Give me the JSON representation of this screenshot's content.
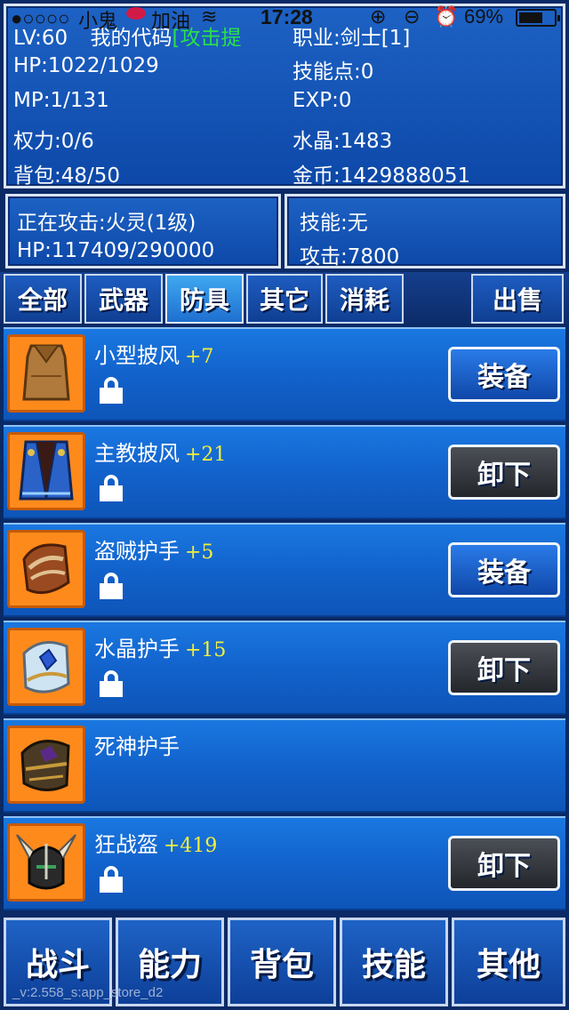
{
  "status_bar": {
    "signal": "●○○○○",
    "carrier": "小鬼",
    "carrier_suffix": "加油",
    "time": "17:28",
    "battery": "69%",
    "battery_level": 0.69
  },
  "player": {
    "level": "LV:60",
    "name_prefix": "我的代码",
    "name_suffix": "[攻击提",
    "class": "职业:剑士[1]",
    "hp": "HP:1022/1029",
    "skill_points": "技能点:0",
    "mp": "MP:1/131",
    "exp": "EXP:0",
    "power": "权力:0/6",
    "crystal": "水晶:1483",
    "bag": "背包:48/50",
    "gold": "金币:1429888051"
  },
  "target": {
    "attacking": "正在攻击:火灵(1级)",
    "hp": "HP:117409/290000"
  },
  "skill": {
    "name": "技能:无",
    "attack": "攻击:7800"
  },
  "tabs": [
    {
      "label": "全部",
      "active": false
    },
    {
      "label": "武器",
      "active": false
    },
    {
      "label": "防具",
      "active": true
    },
    {
      "label": "其它",
      "active": false
    },
    {
      "label": "消耗",
      "active": false
    }
  ],
  "sell_label": "出售",
  "items": [
    {
      "name": "小型披风",
      "bonus": "+7",
      "locked": true,
      "action": "装备",
      "icon": "cloak-brown-icon"
    },
    {
      "name": "主教披风",
      "bonus": "+21",
      "locked": true,
      "action": "卸下",
      "icon": "cloak-blue-icon"
    },
    {
      "name": "盗贼护手",
      "bonus": "+5",
      "locked": true,
      "action": "装备",
      "icon": "gauntlet-brown-icon"
    },
    {
      "name": "水晶护手",
      "bonus": "+15",
      "locked": true,
      "action": "卸下",
      "icon": "gauntlet-crystal-icon"
    },
    {
      "name": "死神护手",
      "bonus": "",
      "locked": false,
      "action": "",
      "icon": "gauntlet-dark-icon"
    },
    {
      "name": "狂战盔",
      "bonus": "+419",
      "locked": true,
      "action": "卸下",
      "icon": "helmet-horned-icon"
    }
  ],
  "bottom_nav": [
    "战斗",
    "能力",
    "背包",
    "技能",
    "其他"
  ],
  "version": "_v:2.558_s:app_store_d2",
  "colors": {
    "panel_blue": "#1d62c4",
    "highlight_green": "#2be04a",
    "bonus_yellow": "#f4f03a",
    "icon_orange": "#ff8a1c",
    "unequip_gray": "#3a3d43"
  }
}
